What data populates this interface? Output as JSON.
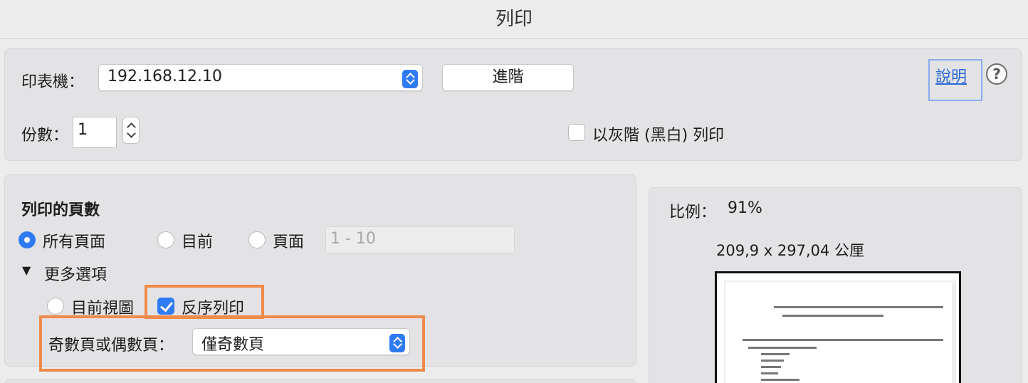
{
  "window": {
    "title": "列印"
  },
  "printer": {
    "label": "印表機：",
    "selected": "192.168.12.10",
    "advanced_button": "進階"
  },
  "help": {
    "link": "說明",
    "icon_glyph": "?"
  },
  "copies": {
    "label": "份數：",
    "value": "1"
  },
  "grayscale": {
    "label": "以灰階 (黑白) 列印",
    "checked": false
  },
  "pages": {
    "heading": "列印的頁數",
    "all": "所有頁面",
    "current": "目前",
    "range": "頁面",
    "range_placeholder": "1 - 10",
    "more_options": "更多選項",
    "current_view": "目前視圖",
    "reverse": "反序列印",
    "odd_even_label": "奇數頁或偶數頁：",
    "odd_even_value": "僅奇數頁"
  },
  "preview": {
    "scale_label": "比例：",
    "scale_value": "91%",
    "dimensions": "209,9 x 297,04 公厘"
  },
  "colors": {
    "accent": "#2f7bf5",
    "highlight": "#f08a4b",
    "link": "#2a6ad6"
  }
}
